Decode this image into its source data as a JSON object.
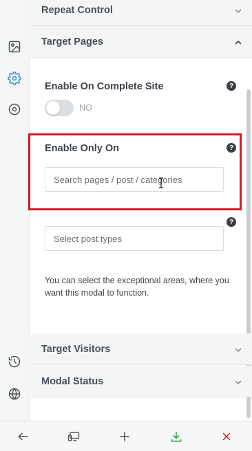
{
  "rail": {
    "icons": [
      "image-icon",
      "gear-icon",
      "target-icon",
      "history-icon",
      "globe-icon"
    ],
    "active_color": "#2f8fd6"
  },
  "sections": {
    "repeat_control": {
      "title": "Repeat Control"
    },
    "target_pages": {
      "title": "Target Pages"
    },
    "target_visitors": {
      "title": "Target Visitors"
    },
    "modal_status": {
      "title": "Modal Status"
    }
  },
  "target_pages": {
    "complete_site": {
      "label": "Enable On Complete Site",
      "toggle_value": "NO",
      "enabled": false
    },
    "enable_only_on": {
      "label": "Enable Only On",
      "placeholder": "Search pages / post / categories",
      "value": ""
    },
    "post_types": {
      "placeholder": "Select post types",
      "value": ""
    },
    "help_text": "You can select the exceptional areas, where you want this modal to function.",
    "help_icon": "?"
  },
  "toolbar": {
    "icons": [
      "back-arrow-icon",
      "responsive-preview-icon",
      "add-icon",
      "download-icon",
      "close-icon"
    ],
    "save_color": "#2ea24a",
    "close_color": "#d9292e"
  },
  "highlight_color": "#d8181f"
}
